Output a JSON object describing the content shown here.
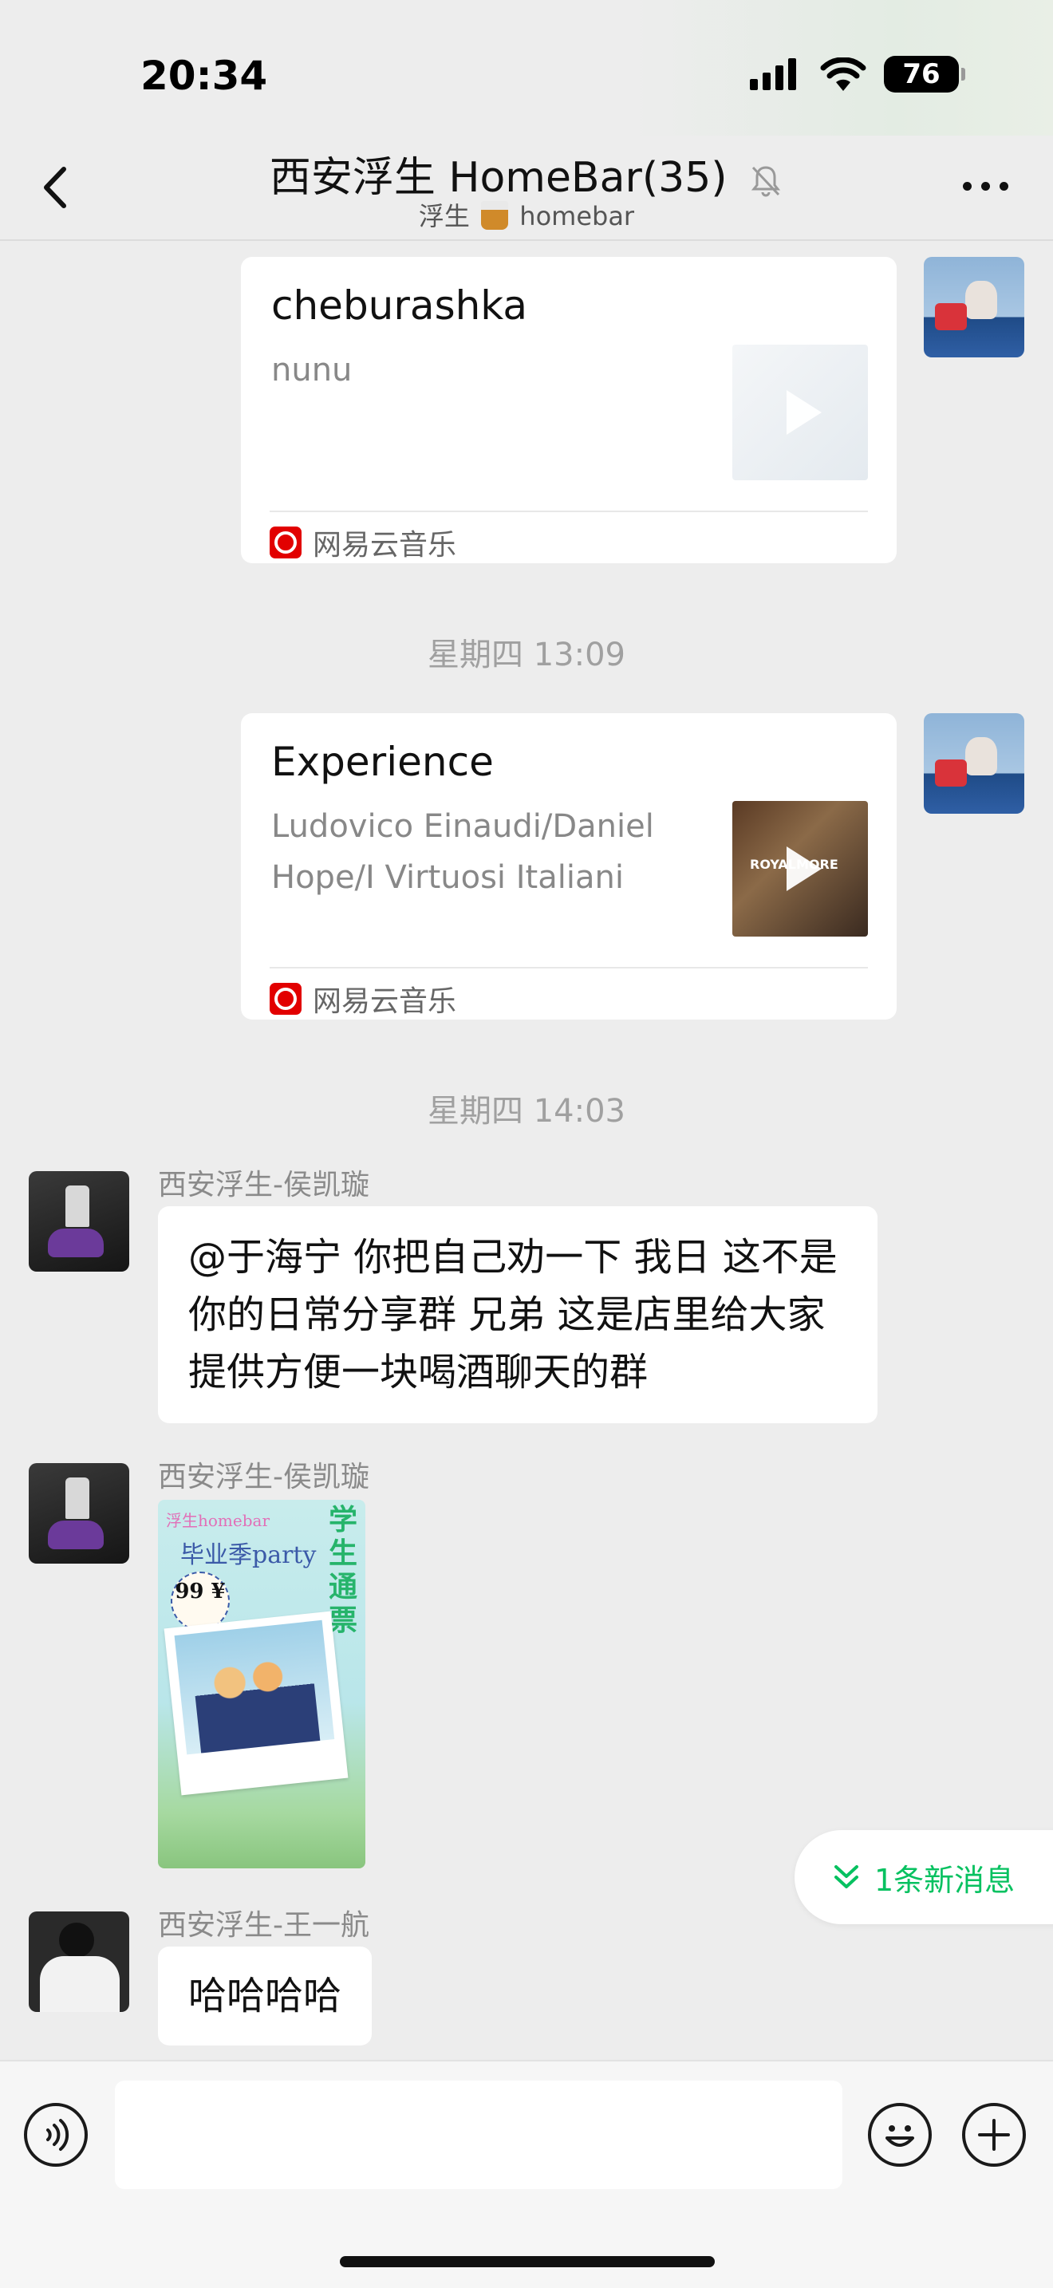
{
  "status_bar": {
    "time": "20:34",
    "battery": "76"
  },
  "header": {
    "title": "西安浮生 HomeBar(35)",
    "subtitle_left": "浮生",
    "subtitle_right": "homebar"
  },
  "messages": [
    {
      "type": "music_card",
      "title": "cheburashka",
      "artist": "nunu",
      "source": "网易云音乐"
    },
    {
      "type": "time_separator",
      "text": "星期四 13:09"
    },
    {
      "type": "music_card",
      "title": "Experience",
      "artist": "Ludovico Einaudi/Daniel Hope/I Virtuosi Italiani",
      "source": "网易云音乐",
      "thumb_text": "ROYALMORE"
    },
    {
      "type": "time_separator",
      "text": "星期四 14:03"
    },
    {
      "type": "text",
      "sender": "西安浮生-侯凯璇",
      "text": "@于海宁 你把自己劝一下 我日 这不是你的日常分享群 兄弟 这是店里给大家提供方便一块喝酒聊天的群"
    },
    {
      "type": "image",
      "sender": "西安浮生-侯凯璇",
      "poster_brand": "浮生homebar",
      "poster_title": "毕业季party",
      "poster_side": "学生通票",
      "poster_price": "99 ¥"
    },
    {
      "type": "text",
      "sender": "西安浮生-王一航",
      "text": "哈哈哈哈"
    }
  ],
  "new_message_banner": "1条新消息",
  "input": {
    "placeholder": ""
  },
  "colors": {
    "accent": "#07c160",
    "background": "#ededed",
    "netease_red": "#e20000"
  }
}
